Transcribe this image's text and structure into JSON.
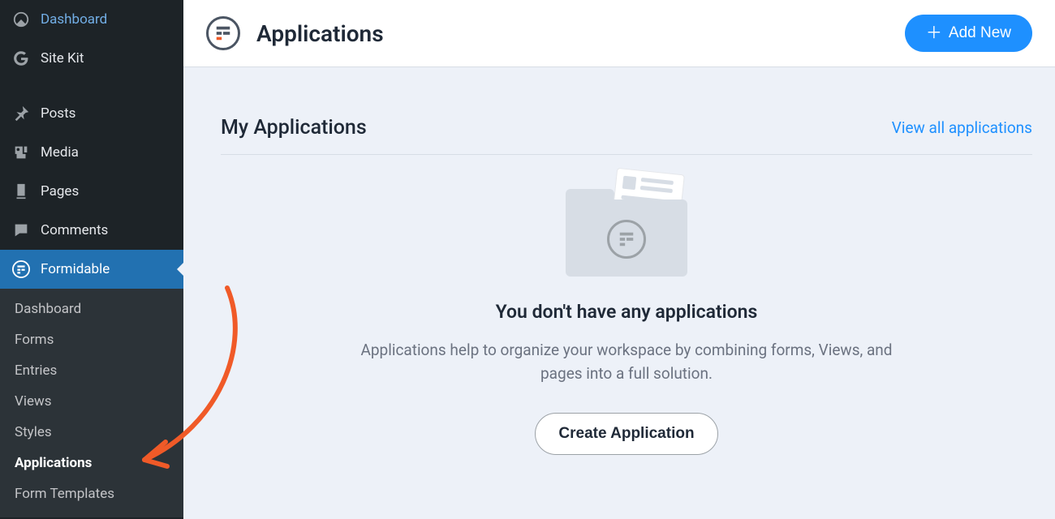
{
  "sidebar": {
    "menu": {
      "dashboard": "Dashboard",
      "sitekit": "Site Kit",
      "posts": "Posts",
      "media": "Media",
      "pages": "Pages",
      "comments": "Comments",
      "formidable": "Formidable"
    },
    "submenu": {
      "dashboard": "Dashboard",
      "forms": "Forms",
      "entries": "Entries",
      "views": "Views",
      "styles": "Styles",
      "applications": "Applications",
      "form_templates": "Form Templates"
    }
  },
  "header": {
    "title": "Applications",
    "add_new": "Add New"
  },
  "section": {
    "title": "My Applications",
    "view_all": "View all applications"
  },
  "empty": {
    "title": "You don't have any applications",
    "desc": "Applications help to organize your workspace by combining forms, Views, and pages into a full solution.",
    "button": "Create Application"
  }
}
